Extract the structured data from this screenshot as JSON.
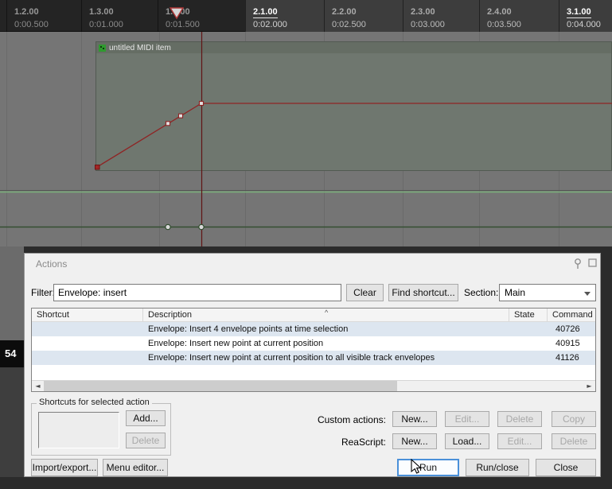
{
  "ruler": {
    "ticks": [
      {
        "beat": "1.2.00",
        "time": "0:00.500"
      },
      {
        "beat": "1.3.00",
        "time": "0:01.000"
      },
      {
        "beat": "1.4.00",
        "time": "0:01.500"
      },
      {
        "beat": "2.1.00",
        "time": "0:02.000"
      },
      {
        "beat": "2.2.00",
        "time": "0:02.500"
      },
      {
        "beat": "2.3.00",
        "time": "0:03.000"
      },
      {
        "beat": "2.4.00",
        "time": "0:03.500"
      },
      {
        "beat": "3.1.00",
        "time": "0:04.000"
      }
    ]
  },
  "arrange": {
    "item_title": "untitled MIDI item",
    "track_label": "54"
  },
  "icons": {
    "sort_ascending": "^",
    "scroll_left": "◄",
    "scroll_right": "►"
  },
  "dialog": {
    "title": "Actions",
    "filter_label": "Filter:",
    "filter_value": "Envelope: insert",
    "clear_button": "Clear",
    "find_shortcut_button": "Find shortcut...",
    "section_label": "Section:",
    "section_value": "Main",
    "table": {
      "columns": [
        "Shortcut",
        "Description",
        "State",
        "Command ID"
      ],
      "rows": [
        {
          "shortcut": "",
          "description": "Envelope: Insert 4 envelope points at time selection",
          "state": "",
          "command_id": "40726"
        },
        {
          "shortcut": "",
          "description": "Envelope: Insert new point at current position",
          "state": "",
          "command_id": "40915"
        },
        {
          "shortcut": "",
          "description": "Envelope: Insert new point at current position to all visible track envelopes",
          "state": "",
          "command_id": "41126"
        }
      ]
    },
    "shortcuts_group": {
      "label": "Shortcuts for selected action",
      "add_button": "Add...",
      "delete_button": "Delete"
    },
    "custom_actions": {
      "label": "Custom actions:",
      "buttons": [
        "New...",
        "Edit...",
        "Delete",
        "Copy"
      ]
    },
    "reascript": {
      "label": "ReaScript:",
      "buttons": [
        "New...",
        "Load...",
        "Edit...",
        "Delete"
      ]
    },
    "bottom": {
      "import_export": "Import/export...",
      "menu_editor": "Menu editor...",
      "run": "Run",
      "run_close": "Run/close",
      "close": "Close"
    }
  },
  "colors": {
    "focus_accent": "#4a90d9",
    "row_alt": "#dde6f0",
    "envelope_red": "#8f2424",
    "envelope_green": "#344f31",
    "track_bg": "#757575",
    "ruler_selection": "#3d3d3d"
  }
}
